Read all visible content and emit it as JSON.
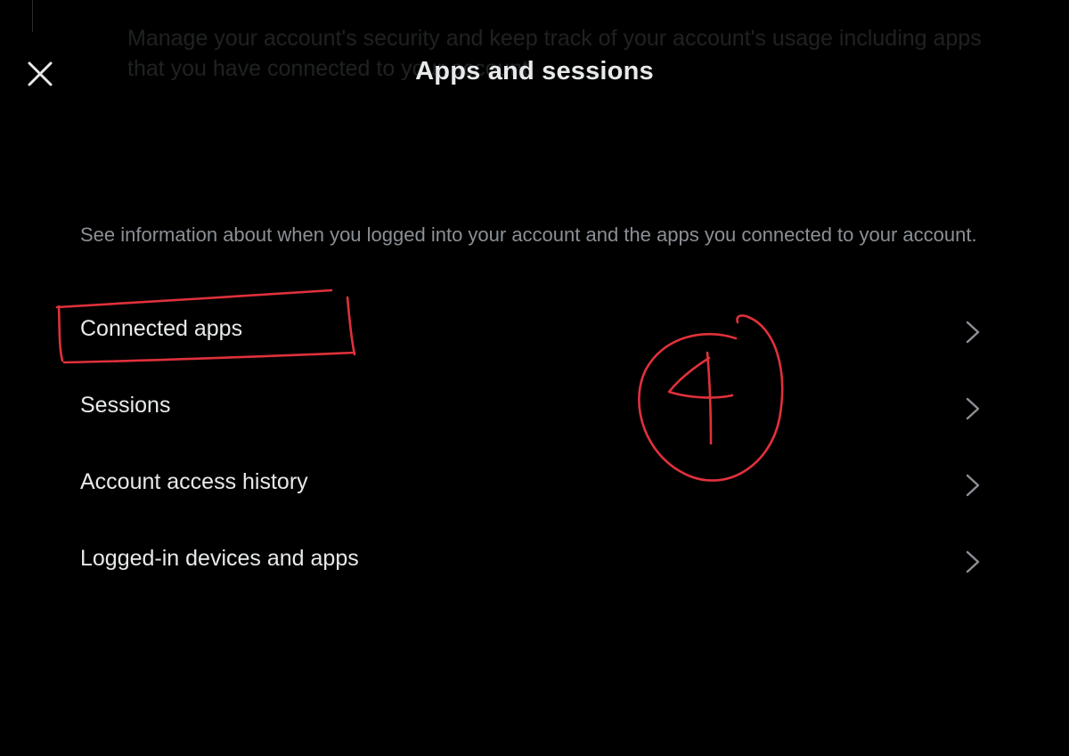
{
  "background_text": {
    "line1": "Manage your account's security and keep track of your account's usage including apps",
    "line2": "that you have connected to your account."
  },
  "header": {
    "close_icon": "close-icon",
    "title": "Apps and sessions"
  },
  "description": "See information about when you logged into your account and the apps you connected to your account.",
  "menu": {
    "items": [
      {
        "label": "Connected apps",
        "icon": "chevron-right-icon"
      },
      {
        "label": "Sessions",
        "icon": "chevron-right-icon"
      },
      {
        "label": "Account access history",
        "icon": "chevron-right-icon"
      },
      {
        "label": "Logged-in devices and apps",
        "icon": "chevron-right-icon"
      }
    ]
  },
  "annotation": {
    "step_number": "4",
    "color": "#e0313b"
  },
  "colors": {
    "background": "#000000",
    "primary_text": "#e7e9ea",
    "secondary_text": "#8b9096"
  }
}
